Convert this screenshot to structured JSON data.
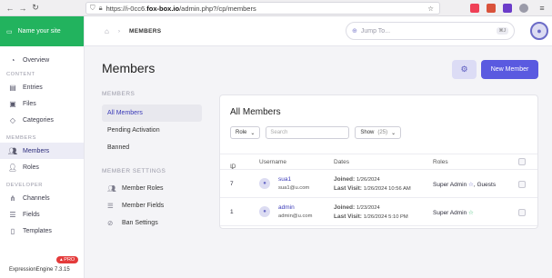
{
  "browser": {
    "url_prefix": "https://i-0cc6.",
    "url_host": "fox-box.io",
    "url_path": "/admin.php?/cp/members"
  },
  "sidebar": {
    "site_name": "Name your site",
    "overview": "Overview",
    "content_heading": "CONTENT",
    "entries": "Entries",
    "files": "Files",
    "categories": "Categories",
    "members_heading": "MEMBERS",
    "members": "Members",
    "roles": "Roles",
    "developer_heading": "DEVELOPER",
    "channels": "Channels",
    "fields": "Fields",
    "templates": "Templates",
    "version": "ExpressionEngine 7.3.15",
    "pro_badge": "PRO"
  },
  "topbar": {
    "breadcrumb_current": "MEMBERS",
    "jump_placeholder": "Jump To...",
    "jump_shortcut": "⌘J"
  },
  "page": {
    "title": "Members",
    "new_member_label": "New Member"
  },
  "submenu": {
    "heading": "MEMBERS",
    "all_members": "All Members",
    "pending": "Pending Activation",
    "banned": "Banned",
    "settings_heading": "MEMBER SETTINGS",
    "member_roles": "Member Roles",
    "member_fields": "Member Fields",
    "ban_settings": "Ban Settings"
  },
  "panel": {
    "title": "All Members",
    "role_filter": "Role",
    "search_placeholder": "Search",
    "show_filter": "Show",
    "show_count": "(25)",
    "columns": {
      "id": "ID",
      "username": "Username",
      "dates": "Dates",
      "roles": "Roles"
    },
    "rows": [
      {
        "id": "7",
        "username": "sua1",
        "email": "sua1@u.com",
        "joined_label": "Joined:",
        "joined": "1/26/2024",
        "last_visit_label": "Last Visit:",
        "last_visit": "1/26/2024 10:56 AM",
        "roles": "Super Admin",
        "roles_extra": ", Guests"
      },
      {
        "id": "1",
        "username": "admin",
        "email": "admin@u.com",
        "joined_label": "Joined:",
        "joined": "1/23/2024",
        "last_visit_label": "Last Visit:",
        "last_visit": "1/26/2024 5:10 PM",
        "roles": "Super Admin",
        "roles_extra": ""
      }
    ]
  },
  "colors": {
    "brand_green": "#22b35e",
    "accent": "#5a5ae0"
  }
}
